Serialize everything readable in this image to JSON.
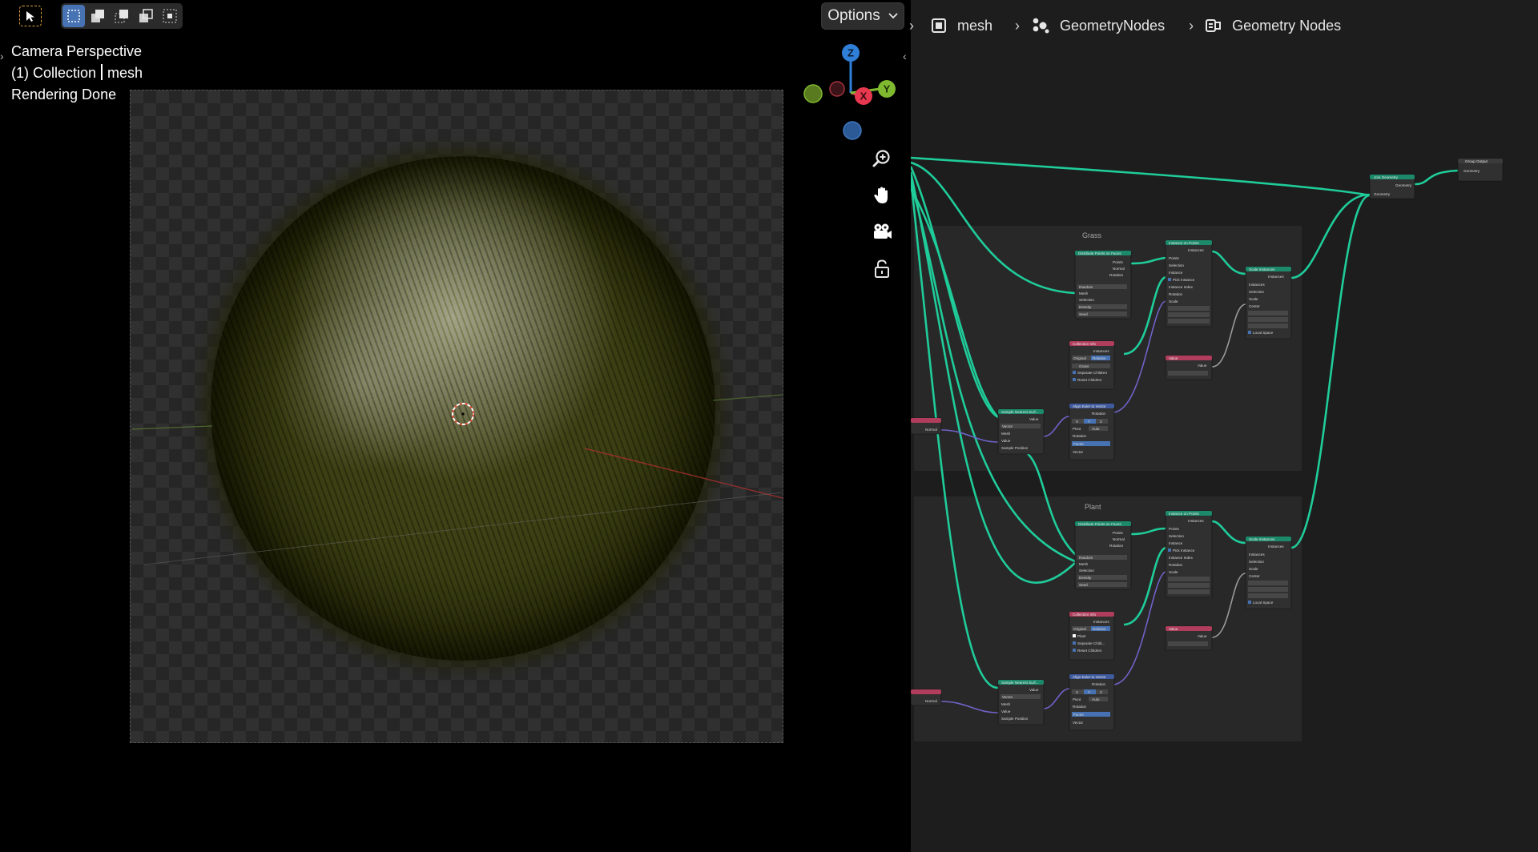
{
  "viewport": {
    "options_label": "Options",
    "overlay": {
      "view_name": "Camera Perspective",
      "collection": "(1) Collection",
      "object": "mesh",
      "status": "Rendering Done"
    },
    "gizmo": {
      "z_label": "Z",
      "x_label": "X",
      "y_label": "Y",
      "colors": {
        "x": "#e8384f",
        "y": "#7fb92f",
        "z": "#2f7fd8",
        "neg_x": "#7a2a34",
        "neg_y": "#5a7a20",
        "neg_z": "#2c5a96"
      }
    },
    "nav_icons": [
      "zoom-icon",
      "pan-hand-icon",
      "camera-icon",
      "lock-icon"
    ],
    "toolbar_icons": [
      "select-cursor-icon",
      "select-box-new-icon",
      "select-box-extend-icon",
      "select-box-subtract-icon",
      "select-box-invert-icon",
      "select-box-intersect-icon"
    ]
  },
  "node_editor": {
    "breadcrumb": [
      {
        "label": "mesh",
        "icon": "mesh-object-icon"
      },
      {
        "label": "GeometryNodes",
        "icon": "geometry-nodes-modifier-icon"
      },
      {
        "label": "Geometry Nodes",
        "icon": "node-tree-icon"
      }
    ],
    "frames": [
      {
        "label": "Grass"
      },
      {
        "label": "Plant"
      }
    ],
    "nodes": {
      "join_geometry": {
        "title": "Join Geometry",
        "rows": [
          "Geometry",
          "Geometry"
        ]
      },
      "group_output": {
        "title": "Group Output",
        "rows": [
          "Geometry"
        ]
      },
      "distribute": {
        "title": "Distribute Points on Faces",
        "rows": [
          "Points",
          "Normal",
          "Rotation",
          "Random",
          "Mesh",
          "Selection",
          "Density",
          "Seed"
        ]
      },
      "instance_on_points": {
        "title": "Instance on Points",
        "rows": [
          "Instances",
          "Points",
          "Selection",
          "Instance",
          "Pick Instance",
          "Instance Index",
          "Rotation",
          "Scale"
        ]
      },
      "scale_instances": {
        "title": "Scale Instances",
        "rows": [
          "Instances",
          "Instances",
          "Selection",
          "Scale",
          "Center",
          "Local Space"
        ]
      },
      "collection_info_grass": {
        "title": "Collection Info",
        "rows": [
          "Instances",
          "Original",
          "Relative",
          "Grass",
          "Separate Children",
          "Reset Children"
        ]
      },
      "collection_info_plant": {
        "title": "Collection Info",
        "rows": [
          "Instances",
          "Original",
          "Relative",
          "Plant",
          "Separate Child...",
          "Reset Children"
        ]
      },
      "value": {
        "title": "Value",
        "rows": [
          "Value"
        ]
      },
      "sample_nearest": {
        "title": "Sample Nearest Surf...",
        "rows": [
          "Value",
          "Vector",
          "Mesh",
          "Value",
          "Sample Position"
        ]
      },
      "align_euler": {
        "title": "Align Euler to Vector",
        "rows": [
          "Rotation",
          "X",
          "Y",
          "Z",
          "Pivot",
          "Auto",
          "Rotation",
          "Factor",
          "Vector"
        ]
      },
      "normal": {
        "title": "Normal",
        "rows": [
          "Normal"
        ]
      }
    }
  }
}
